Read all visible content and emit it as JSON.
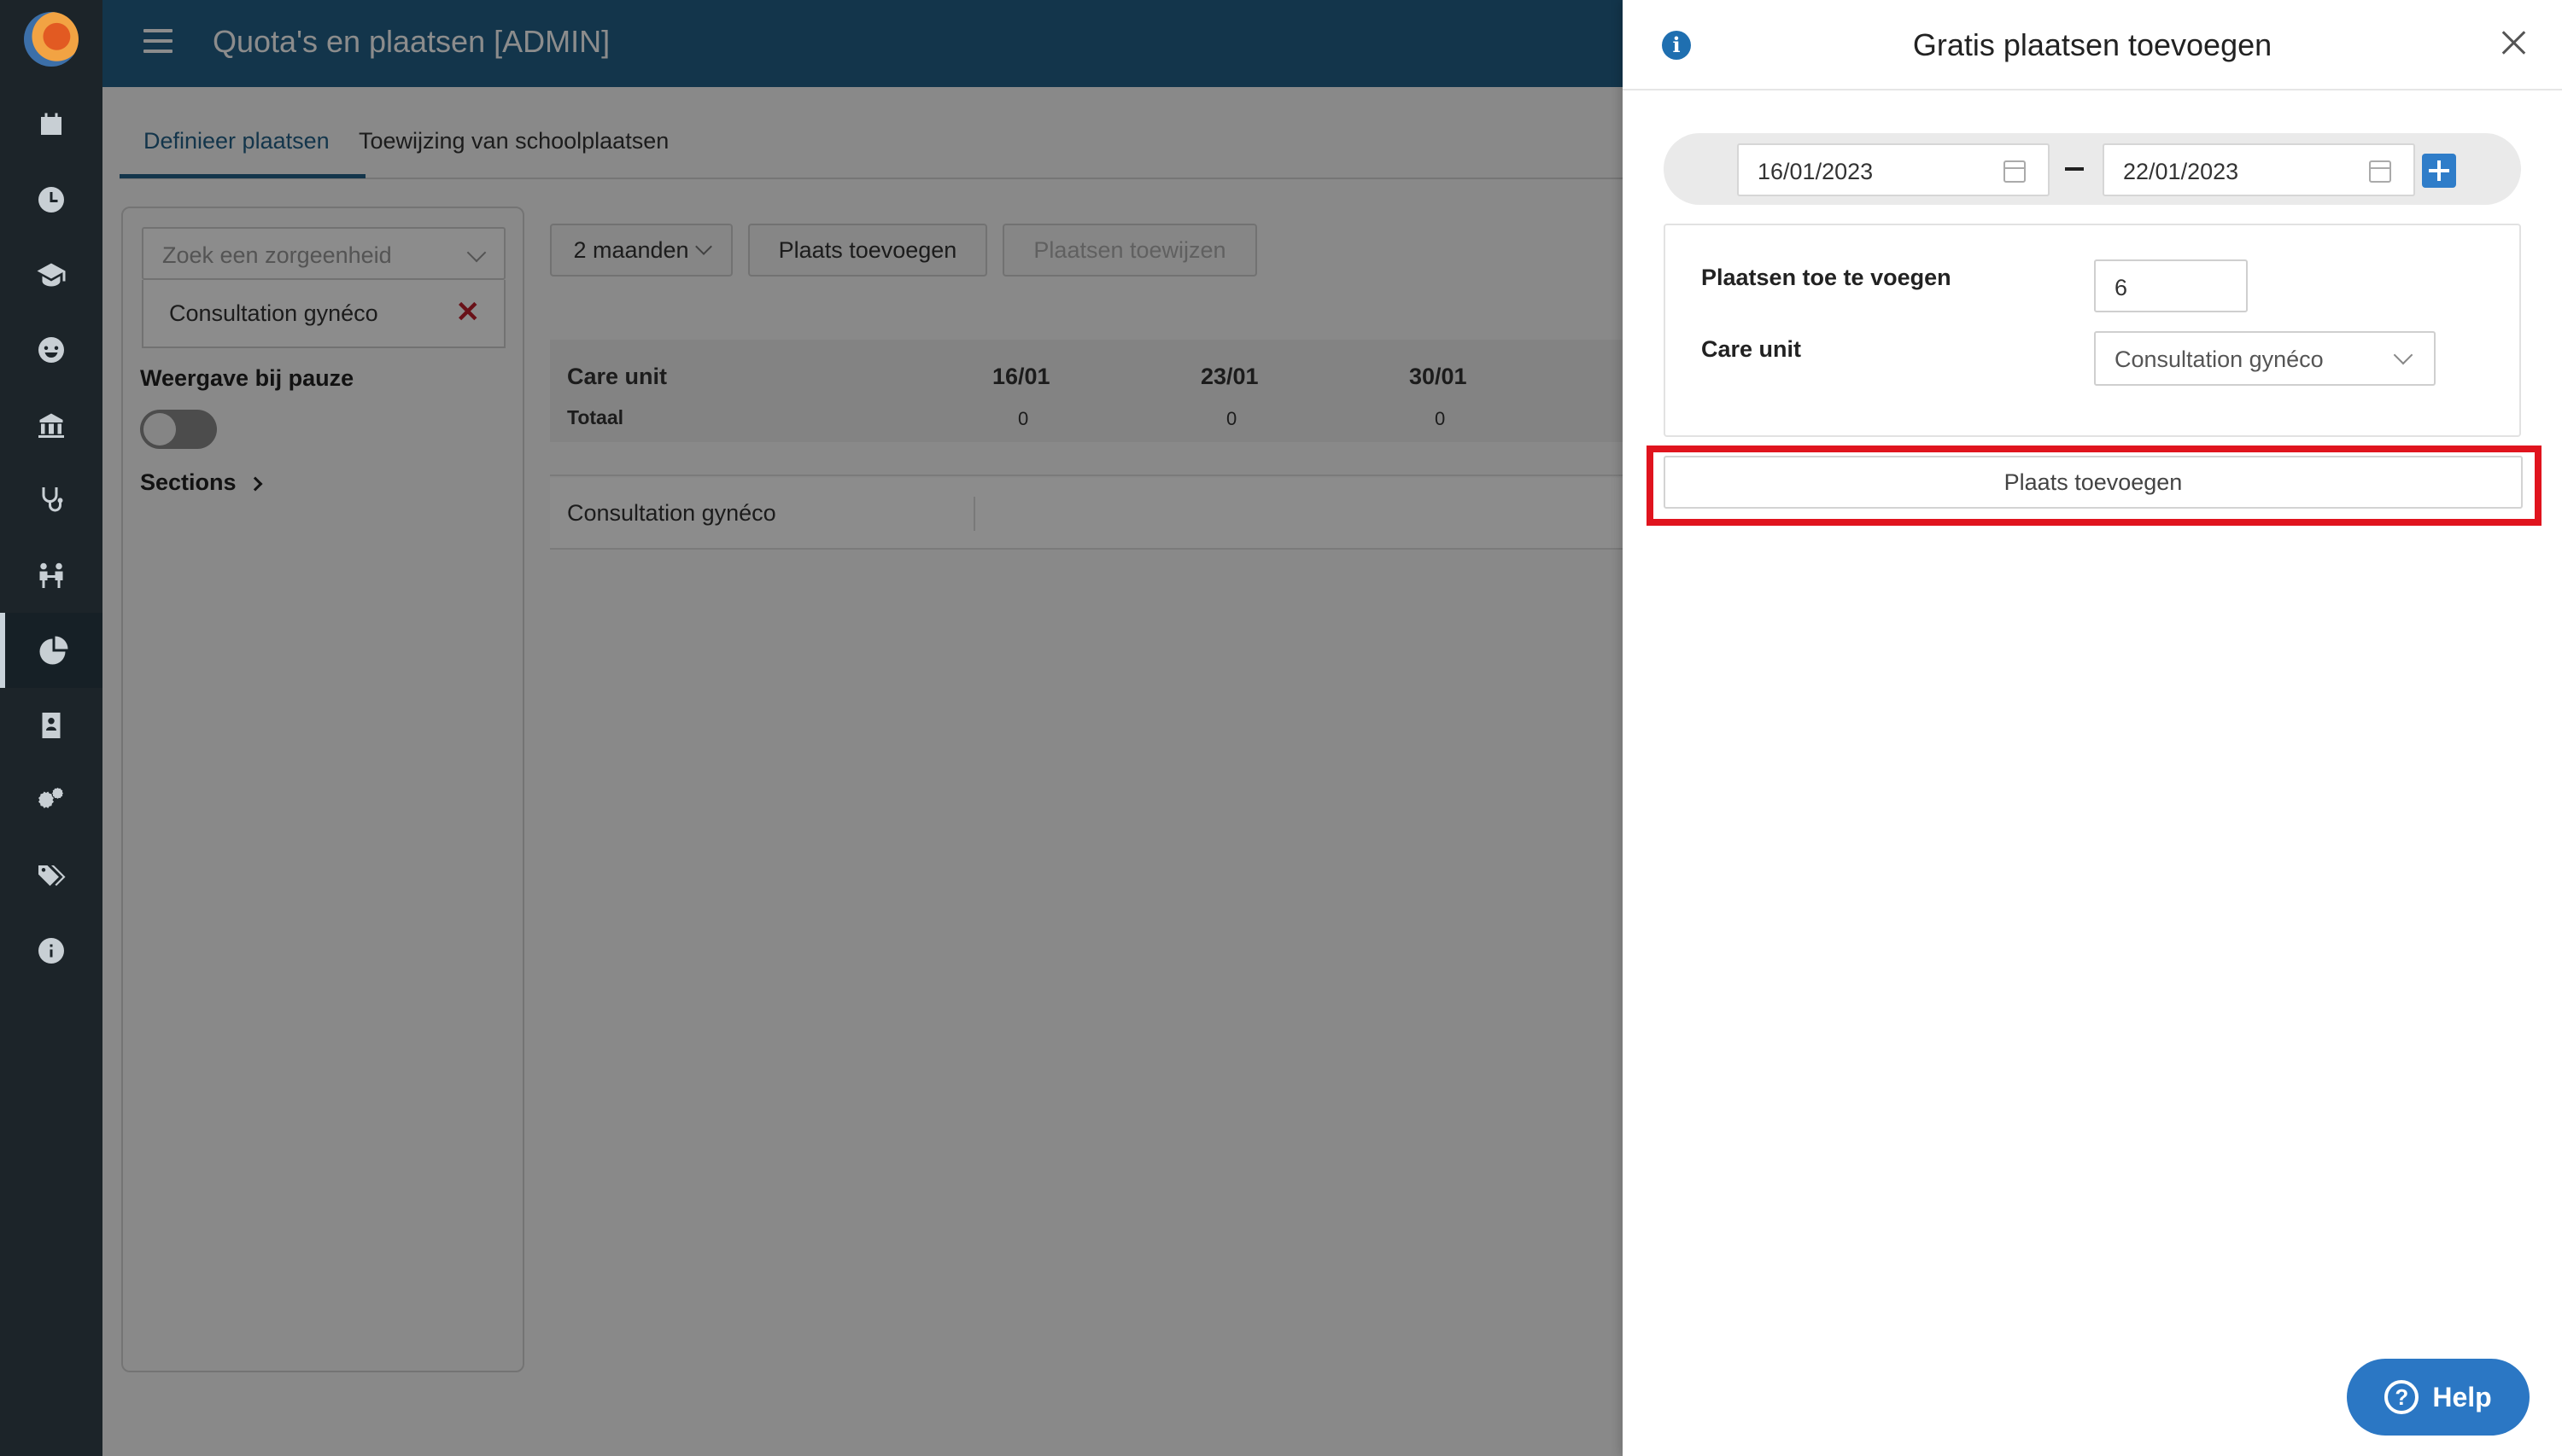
{
  "header": {
    "title": "Quota's en plaatsen [ADMIN]"
  },
  "sidebar": {
    "items": [
      {
        "icon": "calendar-icon"
      },
      {
        "icon": "clock-icon"
      },
      {
        "icon": "graduation-icon"
      },
      {
        "icon": "smiley-icon"
      },
      {
        "icon": "school-icon"
      },
      {
        "icon": "stethoscope-icon"
      },
      {
        "icon": "people-icon"
      },
      {
        "icon": "pie-chart-icon",
        "active": true
      },
      {
        "icon": "contact-book-icon"
      },
      {
        "icon": "gears-icon"
      },
      {
        "icon": "tags-icon"
      },
      {
        "icon": "info-icon"
      }
    ]
  },
  "tabs": [
    {
      "label": "Definieer plaatsen",
      "active": true
    },
    {
      "label": "Toewijzing van schoolplaatsen",
      "active": false
    }
  ],
  "filters": {
    "search_placeholder": "Zoek een zorgeenheid",
    "selected_unit": "Consultation gynéco",
    "pause_label": "Weergave bij pauze",
    "sections_label": "Sections"
  },
  "toolbar": {
    "period": "2 maanden",
    "add_place": "Plaats toevoegen",
    "assign_places": "Plaatsen toewijzen"
  },
  "table": {
    "header": "Care unit",
    "columns": [
      "16/01",
      "23/01",
      "30/01"
    ],
    "total_label": "Totaal",
    "totals": [
      "0",
      "0",
      "0"
    ],
    "rows": [
      {
        "label": "Consultation gynéco"
      }
    ]
  },
  "panel": {
    "title": "Gratis plaatsen toevoegen",
    "date_from": "16/01/2023",
    "date_to": "22/01/2023",
    "places_label": "Plaatsen toe te voegen",
    "places_value": "6",
    "care_unit_label": "Care unit",
    "care_unit_value": "Consultation gynéco",
    "submit_label": "Plaats toevoegen"
  },
  "help": {
    "label": "Help"
  },
  "colors": {
    "header": "#236289",
    "sidebar": "#1c2429",
    "highlight": "#e0141e",
    "accent": "#2f7dc9"
  }
}
